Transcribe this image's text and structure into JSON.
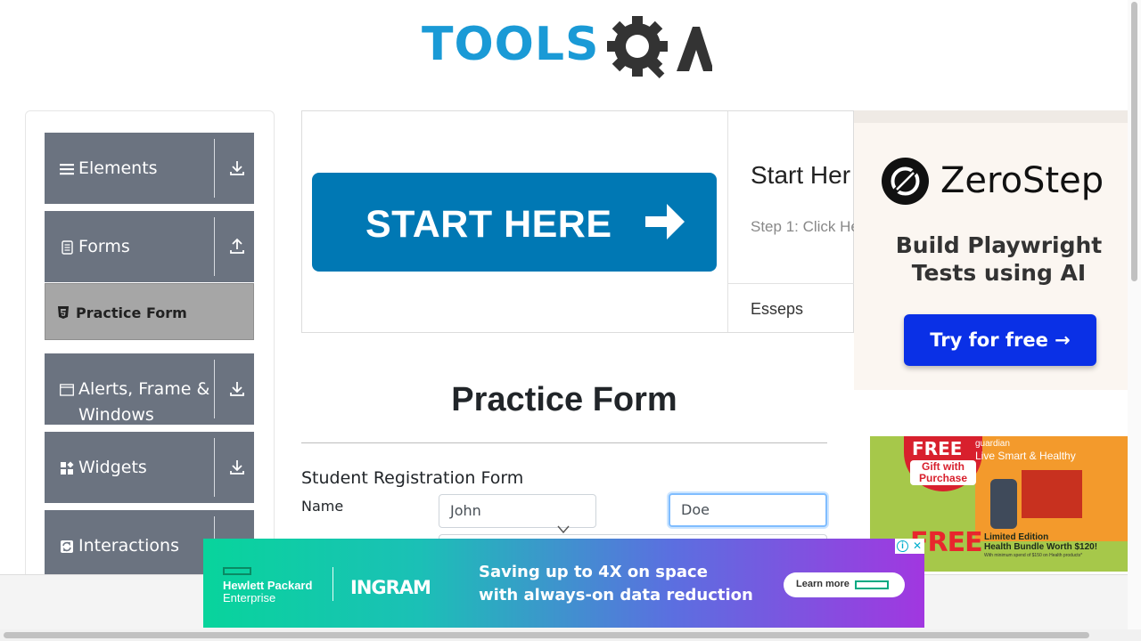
{
  "logo": {
    "text": "TOOLS",
    "suffix": "QA"
  },
  "sidebar": {
    "groups": [
      {
        "label": "Elements",
        "icon": "list-icon",
        "toggle": "download-icon"
      },
      {
        "label": "Forms",
        "icon": "document-icon",
        "toggle": "upload-icon"
      },
      {
        "label": "Alerts, Frame &",
        "label2": "Windows",
        "icon": "window-icon",
        "toggle": "download-icon"
      },
      {
        "label": "Widgets",
        "icon": "widgets-icon",
        "toggle": "download-icon"
      },
      {
        "label": "Interactions",
        "icon": "interactions-icon",
        "toggle": "download-icon"
      }
    ],
    "active_item": {
      "label": "Practice Form",
      "icon": "html5-icon"
    }
  },
  "banner": {
    "button": "START HERE",
    "title": "Start Her",
    "step": "Step 1: Click He",
    "link": "Esseps"
  },
  "ad_zerostep": {
    "brand": "ZeroStep",
    "headline_line1": "Build Playwright",
    "headline_line2": "Tests using AI",
    "cta": "Try for free →"
  },
  "ad_guardian": {
    "badge_big": "FREE",
    "badge_small": "Gift with Purchase",
    "brand": "guardian",
    "tagline": "Live Smart & Healthy",
    "free_big": "FREE",
    "line1": "Limited Edition",
    "line2": "Health Bundle Worth $120!",
    "fine": "With minimum spend of $150 on Health products*"
  },
  "form": {
    "title": "Practice Form",
    "subtitle": "Student Registration Form",
    "name_label": "Name",
    "first_name": "John",
    "last_name": "Doe"
  },
  "ad_hpe": {
    "brand_line1": "Hewlett Packard",
    "brand_line2": "Enterprise",
    "partner": "INGRAM",
    "line1": "Saving up to 4X on space",
    "line2": "with always-on data reduction",
    "cta": "Learn more"
  },
  "colors": {
    "brand_blue": "#1a9ad6",
    "sidebar_gray": "#6b7380",
    "start_button": "#0078b4",
    "zerostep_cta": "#0a30e6"
  }
}
